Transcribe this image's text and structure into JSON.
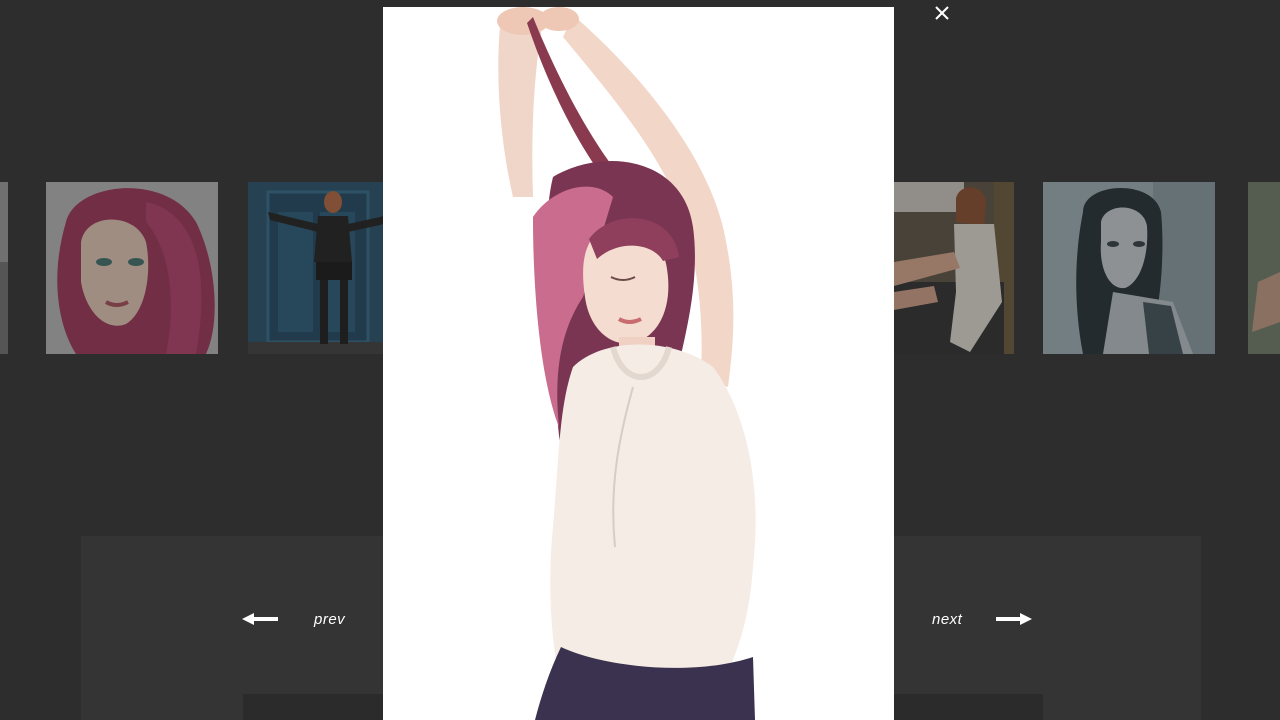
{
  "gallery": {
    "thumbnails": [
      {
        "icon": "photo-thumbnail",
        "subject": "partial"
      },
      {
        "icon": "photo-thumbnail",
        "subject": "portrait-red-hair"
      },
      {
        "icon": "photo-thumbnail",
        "subject": "model-blue-door"
      },
      {
        "icon": "photo-thumbnail",
        "subject": "model-seated"
      },
      {
        "icon": "photo-thumbnail",
        "subject": "portrait-dark-hair"
      },
      {
        "icon": "photo-thumbnail",
        "subject": "partial"
      }
    ]
  },
  "navigation": {
    "prev_label": "prev",
    "next_label": "next",
    "prev_icon": "arrow-left-icon",
    "next_icon": "arrow-right-icon"
  },
  "lightbox": {
    "close_icon": "close-icon",
    "image_icon": "model-photo"
  },
  "colors": {
    "background": "#2d2d2d",
    "panel": "#343434",
    "lightbox_bg": "#ffffff",
    "text": "#ffffff"
  }
}
